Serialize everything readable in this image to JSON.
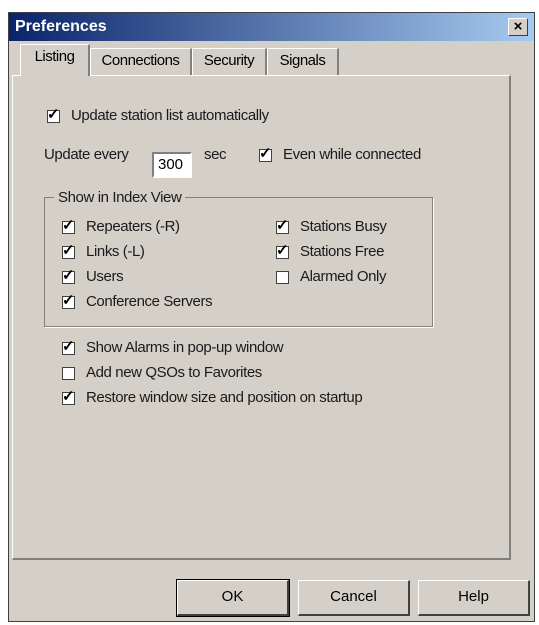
{
  "window": {
    "title": "Preferences",
    "close_glyph": "×"
  },
  "tabs": [
    {
      "label": "Listing",
      "active": true
    },
    {
      "label": "Connections",
      "active": false
    },
    {
      "label": "Security",
      "active": false
    },
    {
      "label": "Signals",
      "active": false
    }
  ],
  "listing": {
    "auto_update": {
      "label": "Update station list automatically",
      "checked": true
    },
    "update_every": {
      "prefix": "Update every",
      "value": "300",
      "suffix": "sec"
    },
    "even_connected": {
      "label": "Even while connected",
      "checked": true
    },
    "index_view": {
      "title": "Show in Index View",
      "repeaters": {
        "label": "Repeaters (-R)",
        "checked": true
      },
      "links": {
        "label": "Links (-L)",
        "checked": true
      },
      "users": {
        "label": "Users",
        "checked": true
      },
      "conf_servers": {
        "label": "Conference Servers",
        "checked": true
      },
      "stations_busy": {
        "label": "Stations Busy",
        "checked": true
      },
      "stations_free": {
        "label": "Stations Free",
        "checked": true
      },
      "alarmed_only": {
        "label": "Alarmed Only",
        "checked": false
      }
    },
    "show_alarms": {
      "label": "Show Alarms in pop-up window",
      "checked": true
    },
    "add_qsos": {
      "label": "Add new QSOs to Favorites",
      "checked": false
    },
    "restore_window": {
      "label": "Restore window size and position on startup",
      "checked": true
    }
  },
  "buttons": {
    "ok": "OK",
    "cancel": "Cancel",
    "help": "Help"
  },
  "check_glyph": "✓"
}
